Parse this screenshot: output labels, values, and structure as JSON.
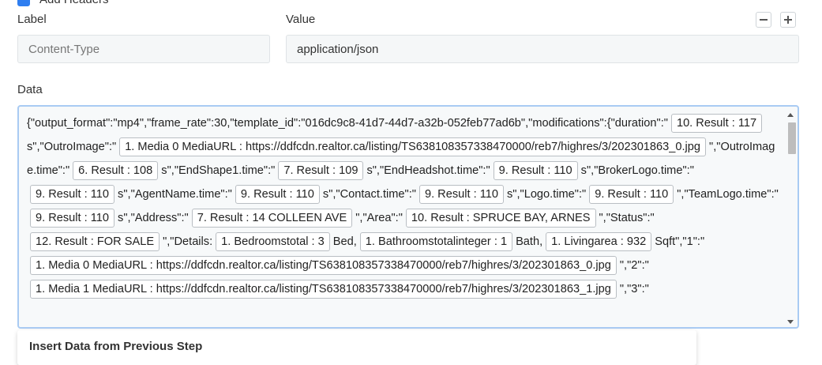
{
  "headers_toggle": {
    "label": "Add Headers",
    "checked": true
  },
  "header": {
    "label_title": "Label",
    "value_title": "Value",
    "label_value": "Content-Type",
    "value_value": "application/json"
  },
  "data_section": {
    "title": "Data",
    "segments": [
      {
        "t": "text",
        "v": "{\"output_format\":\"mp4\",\"frame_rate\":30,\"template_id\":\"016dc9c8-41d7-44d7-a32b-052feb77ad6b\",\"modifications\":{\"duration\":\""
      },
      {
        "t": "chip",
        "v": "10. Result : 117"
      },
      {
        "t": "text",
        "v": "s\",\"OutroImage\":\""
      },
      {
        "t": "chip",
        "v": "1. Media 0 MediaURL : https://ddfcdn.realtor.ca/listing/TS638108357338470000/reb7/highres/3/202301863_0.jpg"
      },
      {
        "t": "text",
        "v": "\",\"OutroImage.time\":\""
      },
      {
        "t": "chip",
        "v": "6. Result : 108"
      },
      {
        "t": "text",
        "v": "s\",\"EndShape1.time\":\""
      },
      {
        "t": "chip",
        "v": "7. Result : 109"
      },
      {
        "t": "text",
        "v": "s\",\"EndHeadshot.time\":\""
      },
      {
        "t": "chip",
        "v": "9. Result : 110"
      },
      {
        "t": "text",
        "v": "s\",\"BrokerLogo.time\":\""
      },
      {
        "t": "chip",
        "v": "9. Result : 110"
      },
      {
        "t": "text",
        "v": "s\",\"AgentName.time\":\""
      },
      {
        "t": "chip",
        "v": "9. Result : 110"
      },
      {
        "t": "text",
        "v": "s\",\"Contact.time\":\""
      },
      {
        "t": "chip",
        "v": "9. Result : 110"
      },
      {
        "t": "text",
        "v": "s\",\"Logo.time\":\""
      },
      {
        "t": "chip",
        "v": "9. Result : 110"
      },
      {
        "t": "text",
        "v": "\",\"TeamLogo.time\":\""
      },
      {
        "t": "chip",
        "v": "9. Result : 110"
      },
      {
        "t": "text",
        "v": "s\",\"Address\":\""
      },
      {
        "t": "chip",
        "v": "7. Result : 14 COLLEEN AVE"
      },
      {
        "t": "text",
        "v": "\",\"Area\":\""
      },
      {
        "t": "chip",
        "v": "10. Result : SPRUCE BAY, ARNES"
      },
      {
        "t": "text",
        "v": "\",\"Status\":\""
      },
      {
        "t": "chip",
        "v": "12. Result : FOR SALE"
      },
      {
        "t": "text",
        "v": "\",\"Details:"
      },
      {
        "t": "chip",
        "v": "1. Bedroomstotal : 3"
      },
      {
        "t": "text",
        "v": "Bed,"
      },
      {
        "t": "chip",
        "v": "1. Bathroomstotalinteger : 1"
      },
      {
        "t": "text",
        "v": "Bath,"
      },
      {
        "t": "chip",
        "v": "1. Livingarea : 932"
      },
      {
        "t": "text",
        "v": "Sqft\",\"1\":\""
      },
      {
        "t": "chip",
        "v": "1. Media 0 MediaURL : https://ddfcdn.realtor.ca/listing/TS638108357338470000/reb7/highres/3/202301863_0.jpg"
      },
      {
        "t": "text",
        "v": "\",\"2\":\""
      },
      {
        "t": "chip",
        "v": "1. Media 1 MediaURL : https://ddfcdn.realtor.ca/listing/TS638108357338470000/reb7/highres/3/202301863_1.jpg"
      },
      {
        "t": "text",
        "v": "\",\"3\":\""
      }
    ]
  },
  "dropdown": {
    "item": "Insert Data from Previous Step"
  }
}
